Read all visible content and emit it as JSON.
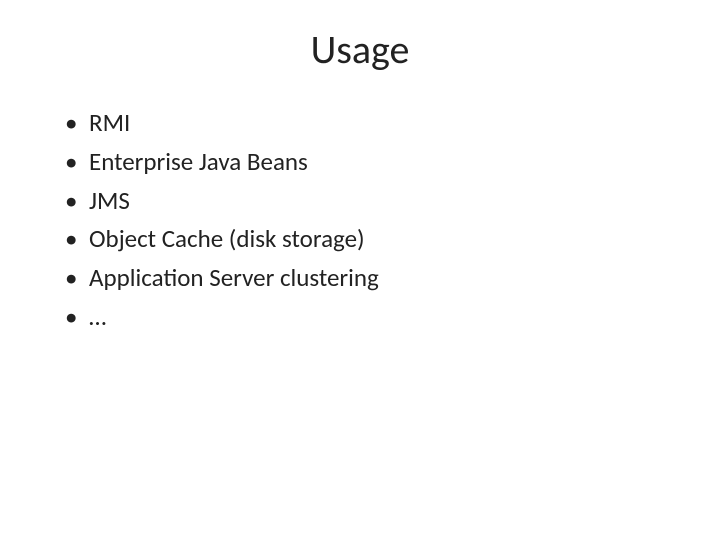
{
  "slide": {
    "title": "Usage",
    "bullets": [
      "RMI",
      "Enterprise Java Beans",
      "JMS",
      "Object Cache (disk storage)",
      "Application Server clustering",
      "…"
    ]
  }
}
